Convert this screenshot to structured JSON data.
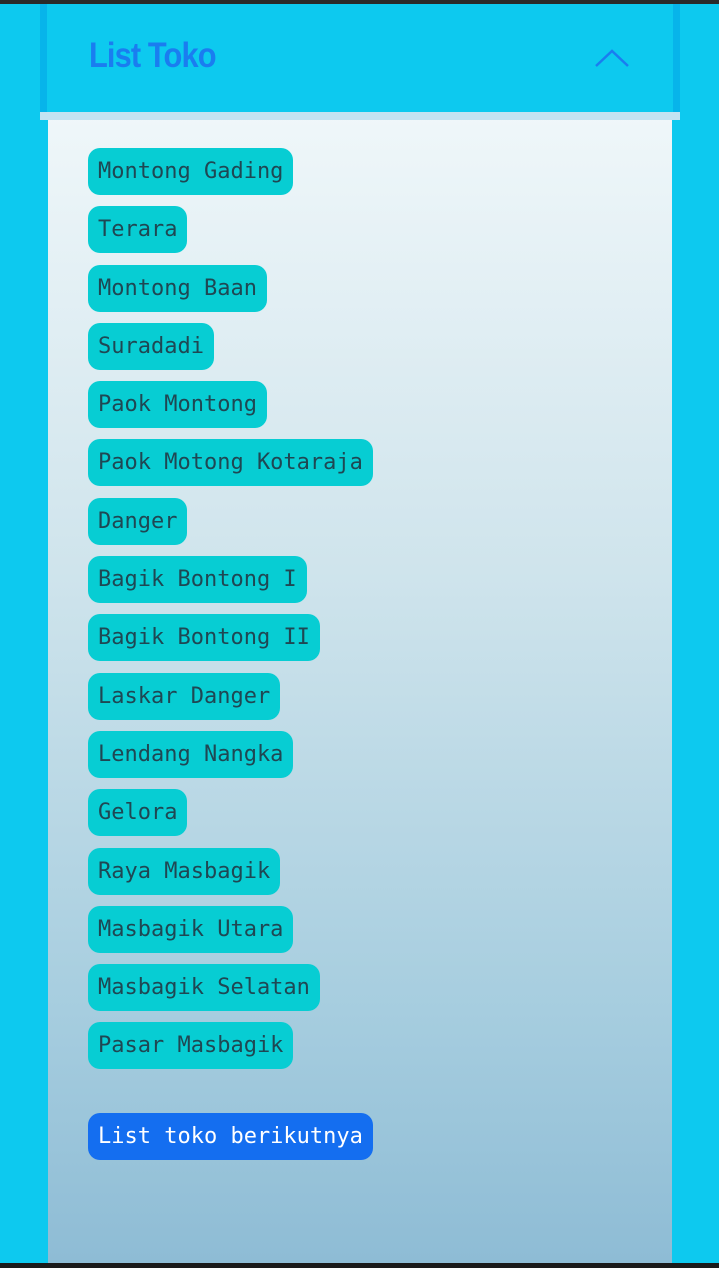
{
  "header": {
    "title": "List Toko",
    "toggle_icon": "chevron-up-icon"
  },
  "stores": [
    "Montong Gading",
    "Terara",
    "Montong Baan",
    "Suradadi",
    "Paok Montong",
    "Paok Motong Kotaraja",
    "Danger",
    "Bagik Bontong I",
    "Bagik Bontong II",
    "Laskar Danger",
    "Lendang Nangka",
    "Gelora",
    "Raya Masbagik",
    "Masbagik Utara",
    "Masbagik Selatan",
    "Pasar Masbagik"
  ],
  "next_button": {
    "label": "List toko berikutnya"
  },
  "colors": {
    "page_background": "#0dc9ef",
    "title": "#1a7df0",
    "store_pill": "#07cdd3",
    "store_text": "#1f4753",
    "next_button": "#146ef0"
  }
}
